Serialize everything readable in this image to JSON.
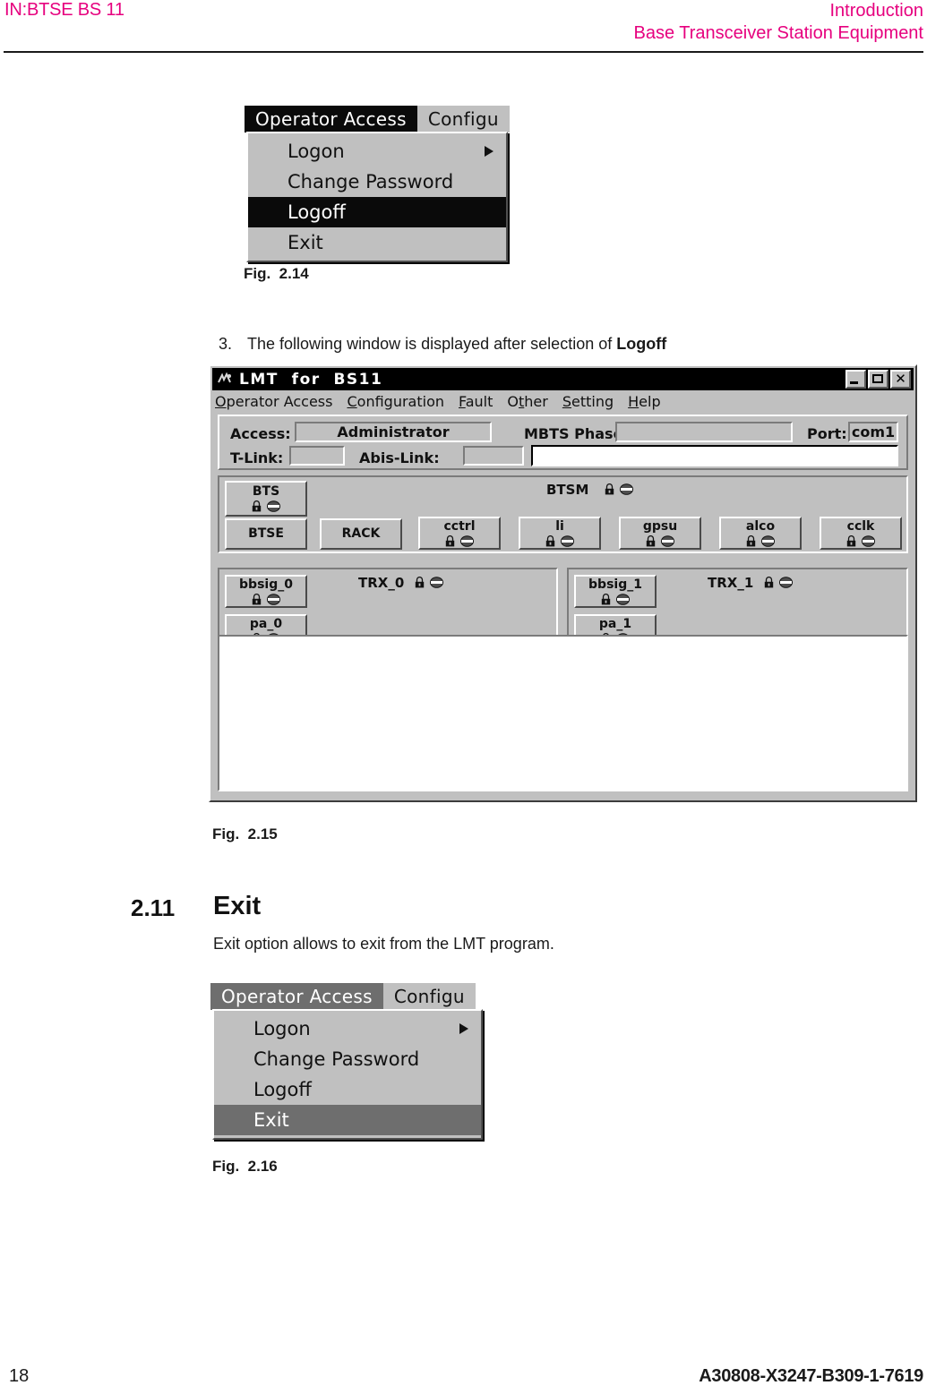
{
  "header": {
    "left": "IN:BTSE BS 11",
    "right_line1": "Introduction",
    "right_line2": "Base Transceiver Station Equipment"
  },
  "footer": {
    "page_number": "18",
    "doc_id": "A30808-X3247-B309-1-7619"
  },
  "figures": {
    "fig_214_caption": "Fig.  2.14",
    "fig_215_caption": "Fig.  2.15",
    "fig_216_caption": "Fig.  2.16"
  },
  "step3": {
    "number": "3.",
    "text_before": "The following window is displayed after selection of ",
    "bold_term": "Logoff"
  },
  "section": {
    "number": "2.11",
    "title": "Exit",
    "body": "Exit option allows to exit from the LMT program."
  },
  "menu_fig214": {
    "menubar": [
      {
        "label": "Operator Access",
        "active": true
      },
      {
        "label": "Configu",
        "active": false
      }
    ],
    "items": [
      {
        "label": "Logon",
        "selected": false,
        "submenu": true
      },
      {
        "label": "Change Password",
        "selected": false,
        "submenu": false
      },
      {
        "label": "Logoff",
        "selected": true,
        "submenu": false
      },
      {
        "label": "Exit",
        "selected": false,
        "submenu": false
      }
    ],
    "highlight_color": "#0a0a0a"
  },
  "menu_fig216": {
    "menubar": [
      {
        "label": "Operator Access",
        "active": true
      },
      {
        "label": "Configu",
        "active": false
      }
    ],
    "items": [
      {
        "label": "Logon",
        "selected": false,
        "submenu": true
      },
      {
        "label": "Change Password",
        "selected": false,
        "submenu": false
      },
      {
        "label": "Logoff",
        "selected": false,
        "submenu": false
      },
      {
        "label": "Exit",
        "selected": true,
        "submenu": false
      }
    ],
    "highlight_color": "#6e6e6e"
  },
  "lmt_window": {
    "title": "LMT  for  BS11",
    "titlebar_buttons": [
      "minimize",
      "maximize",
      "close"
    ],
    "menus": [
      {
        "mnemonic": "O",
        "rest": "perator Access"
      },
      {
        "mnemonic": "C",
        "rest": "onfiguration"
      },
      {
        "mnemonic": "F",
        "rest": "ault"
      },
      {
        "pre": "O",
        "mnemonic": "t",
        "rest": "her"
      },
      {
        "mnemonic": "S",
        "rest": "etting"
      },
      {
        "mnemonic": "H",
        "rest": "elp"
      }
    ],
    "fields": {
      "access_label": "Access:",
      "access_value": "Administrator",
      "mbts_label": "MBTS Phase:",
      "mbts_value": "",
      "port_label": "Port:",
      "port_value": "com1",
      "tlink_label": "T-Link:",
      "tlink_value": "",
      "abislink_label": "Abis-Link:",
      "abislink_value": "",
      "message_value": ""
    },
    "btsm_group": {
      "label": "BTSM",
      "has_status": true,
      "nodes": [
        {
          "label": "BTS",
          "status": true
        },
        {
          "label": "BTSE",
          "status": false
        },
        {
          "label": "RACK",
          "status": false
        },
        {
          "label": "cctrl",
          "status": true
        },
        {
          "label": "li",
          "status": true
        },
        {
          "label": "gpsu",
          "status": true
        },
        {
          "label": "alco",
          "status": true
        },
        {
          "label": "cclk",
          "status": true
        }
      ]
    },
    "trx_groups": [
      {
        "label": "TRX_0",
        "has_status": true,
        "nodes": [
          {
            "label": "bbsig_0",
            "status": true
          },
          {
            "label": "pa_0",
            "status": true
          }
        ]
      },
      {
        "label": "TRX_1",
        "has_status": true,
        "nodes": [
          {
            "label": "bbsig_1",
            "status": true
          },
          {
            "label": "pa_1",
            "status": true
          }
        ]
      }
    ],
    "icons": {
      "lock": "lock-icon",
      "state": "oval-state-icon"
    }
  }
}
